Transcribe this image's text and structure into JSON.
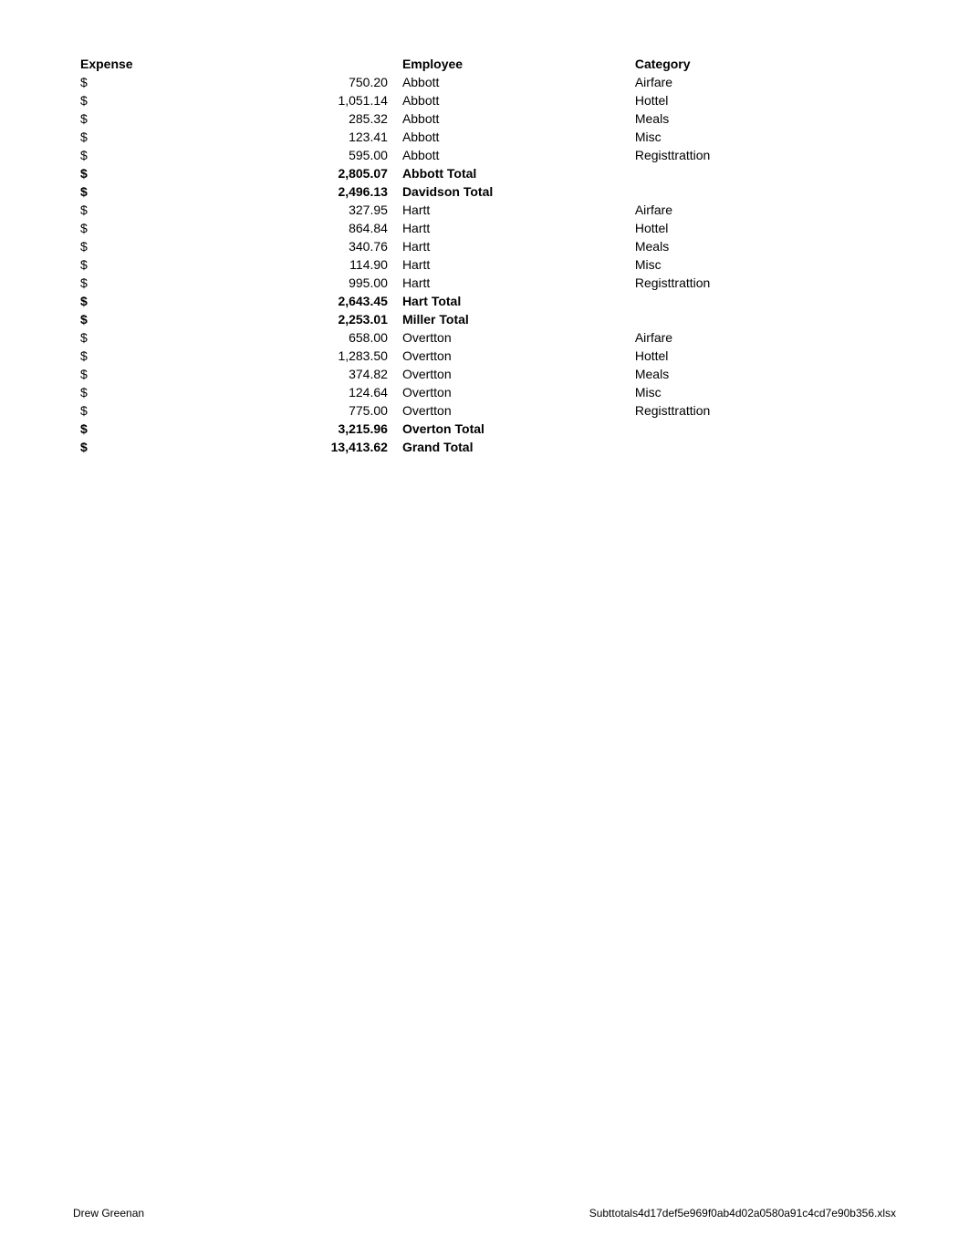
{
  "header": {
    "col_expense": "Expense",
    "col_employee": "Employee",
    "col_category": "Category"
  },
  "rows": [
    {
      "dollar": "$",
      "amount": "750.20",
      "employee": "Abbott",
      "category": "Airfare",
      "is_total": false
    },
    {
      "dollar": "$",
      "amount": "1,051.14",
      "employee": "Abbott",
      "category": "Hottel",
      "is_total": false
    },
    {
      "dollar": "$",
      "amount": "285.32",
      "employee": "Abbott",
      "category": "Meals",
      "is_total": false
    },
    {
      "dollar": "$",
      "amount": "123.41",
      "employee": "Abbott",
      "category": "Misc",
      "is_total": false
    },
    {
      "dollar": "$",
      "amount": "595.00",
      "employee": "Abbott",
      "category": "Registtrattion",
      "is_total": false
    },
    {
      "dollar": "$",
      "amount": "2,805.07",
      "employee": "Abbott Total",
      "category": "",
      "is_total": true
    },
    {
      "dollar": "$",
      "amount": "2,496.13",
      "employee": "Davidson Total",
      "category": "",
      "is_total": true
    },
    {
      "dollar": "$",
      "amount": "327.95",
      "employee": "Hartt",
      "category": "Airfare",
      "is_total": false
    },
    {
      "dollar": "$",
      "amount": "864.84",
      "employee": "Hartt",
      "category": "Hottel",
      "is_total": false
    },
    {
      "dollar": "$",
      "amount": "340.76",
      "employee": "Hartt",
      "category": "Meals",
      "is_total": false
    },
    {
      "dollar": "$",
      "amount": "114.90",
      "employee": "Hartt",
      "category": "Misc",
      "is_total": false
    },
    {
      "dollar": "$",
      "amount": "995.00",
      "employee": "Hartt",
      "category": "Registtrattion",
      "is_total": false
    },
    {
      "dollar": "$",
      "amount": "2,643.45",
      "employee": "Hart Total",
      "category": "",
      "is_total": true
    },
    {
      "dollar": "$",
      "amount": "2,253.01",
      "employee": "Miller Total",
      "category": "",
      "is_total": true
    },
    {
      "dollar": "$",
      "amount": "658.00",
      "employee": "Overtton",
      "category": "Airfare",
      "is_total": false
    },
    {
      "dollar": "$",
      "amount": "1,283.50",
      "employee": "Overtton",
      "category": "Hottel",
      "is_total": false
    },
    {
      "dollar": "$",
      "amount": "374.82",
      "employee": "Overtton",
      "category": "Meals",
      "is_total": false
    },
    {
      "dollar": "$",
      "amount": "124.64",
      "employee": "Overtton",
      "category": "Misc",
      "is_total": false
    },
    {
      "dollar": "$",
      "amount": "775.00",
      "employee": "Overtton",
      "category": "Registtrattion",
      "is_total": false
    },
    {
      "dollar": "$",
      "amount": "3,215.96",
      "employee": "Overton Total",
      "category": "",
      "is_total": true
    },
    {
      "dollar": "$",
      "amount": "13,413.62",
      "employee": "Grand Total",
      "category": "",
      "is_total": true
    }
  ],
  "footer": {
    "left": "Drew Greenan",
    "right": "Subttotals4d17def5e969f0ab4d02a0580a91c4cd7e90b356.xlsx"
  }
}
